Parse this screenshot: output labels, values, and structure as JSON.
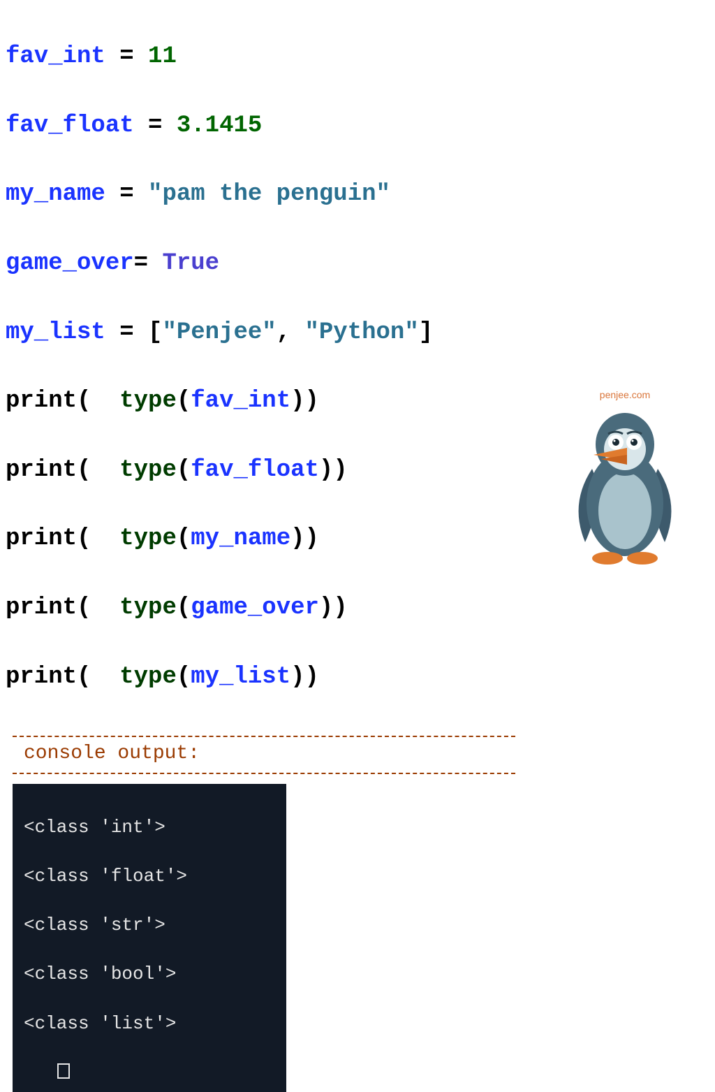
{
  "line1": {
    "var": "fav_int",
    "eq": " = ",
    "val": "11"
  },
  "line2": {
    "var": "fav_float",
    "eq": " = ",
    "val": "3.1415"
  },
  "line3": {
    "var": "my_name",
    "eq": " = ",
    "str": "\"pam the penguin\""
  },
  "line4": {
    "var": "game_over",
    "eq": "= ",
    "kw": "True"
  },
  "line5": {
    "var": "my_list",
    "eq": " = ",
    "lb": "[",
    "s1": "\"Penjee\"",
    "comma": ", ",
    "s2": "\"Python\"",
    "rb": "]"
  },
  "prints": [
    {
      "p": "print",
      "o": "(  ",
      "t": "type",
      "o2": "(",
      "arg": "fav_int",
      "c": "))"
    },
    {
      "p": "print",
      "o": "(  ",
      "t": "type",
      "o2": "(",
      "arg": "fav_float",
      "c": "))"
    },
    {
      "p": "print",
      "o": "(  ",
      "t": "type",
      "o2": "(",
      "arg": "my_name",
      "c": "))"
    },
    {
      "p": "print",
      "o": "(  ",
      "t": "type",
      "o2": "(",
      "arg": "game_over",
      "c": "))"
    },
    {
      "p": "print",
      "o": "(  ",
      "t": "type",
      "o2": "(",
      "arg": "my_list",
      "c": "))"
    }
  ],
  "console_label": "console output:",
  "console_lines": [
    "<class 'int'>",
    "<class 'float'>",
    "<class 'str'>",
    "<class 'bool'>",
    "<class 'list'>"
  ],
  "mascot_label": "penjee.com"
}
